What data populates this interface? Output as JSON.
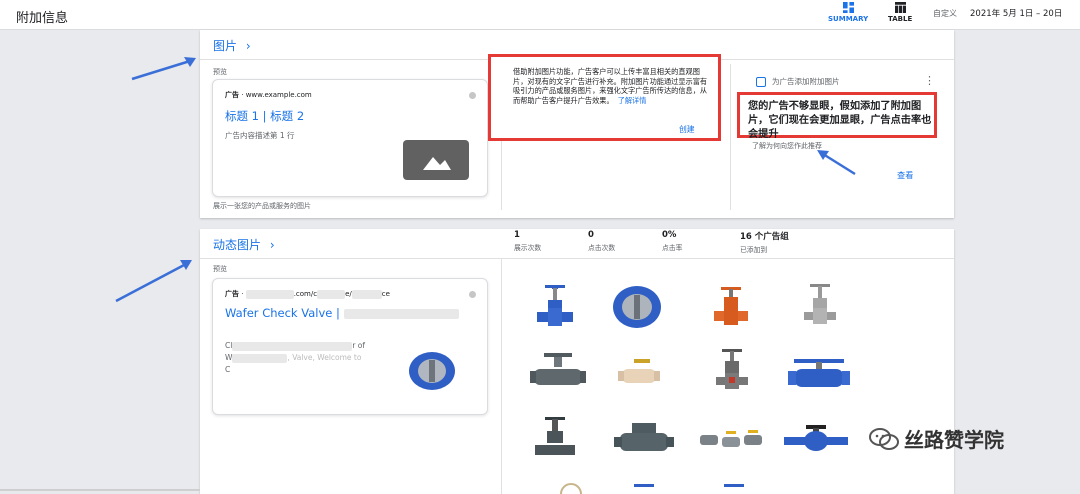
{
  "header": {
    "title": "附加信息",
    "view_summary": "SUMMARY",
    "view_table": "TABLE",
    "date_label": "自定义",
    "date_range": "2021年 5月 1日 – 20日"
  },
  "images_section": {
    "title": "图片",
    "preview_label": "预览",
    "ad_tag": "广告",
    "ad_url": "www.example.com",
    "ad_headline": "标题 1 | 标题 2",
    "ad_description": "广告内容描述第 1 行",
    "caption": "展示一张您的产品或服务的图片",
    "info_text": "借助附加图片功能，广告客户可以上传丰富且相关的直观图片，对现有的文字广告进行补充。附加图片功能通过显示富有吸引力的产品或服务图片，来强化文字广告所传达的信息，从而帮助广告客户提升广告效果。",
    "info_link": "了解详情",
    "create_label": "创建",
    "rec_title": "为广告添加附加图片",
    "rec_text": "您的广告不够显眼，假如添加了附加图片，它们现在会更加显眼，广告点击率也会提升",
    "rec_why": "了解为何向您作此推荐",
    "rec_view": "查看"
  },
  "dynamic_section": {
    "title": "动态图片",
    "preview_label": "预览",
    "stats": [
      {
        "value": "1",
        "label": "展示次数"
      },
      {
        "value": "0",
        "label": "点击次数"
      },
      {
        "value": "0%",
        "label": "点击率"
      },
      {
        "value": "16 个广告组",
        "label": "已添加到"
      }
    ],
    "ad_tag": "广告",
    "ad_url_parts": [
      ".com/c",
      "e/",
      "ce"
    ],
    "ad_headline": "Wafer Check Valve |",
    "ad_desc_line1_start": "Cl",
    "ad_desc_line1_end": "r of",
    "ad_desc_line2_start": "W",
    "ad_desc_line2_mid": ", Valve, Welcome to",
    "ad_desc_line3_start": "C"
  },
  "watermark": {
    "text": "丝路赞学院"
  },
  "colors": {
    "accent": "#1a73e8",
    "highlight_red": "#e53935",
    "arrow_blue": "#3b6fd8",
    "valve_blue": "#2f5fc4"
  }
}
